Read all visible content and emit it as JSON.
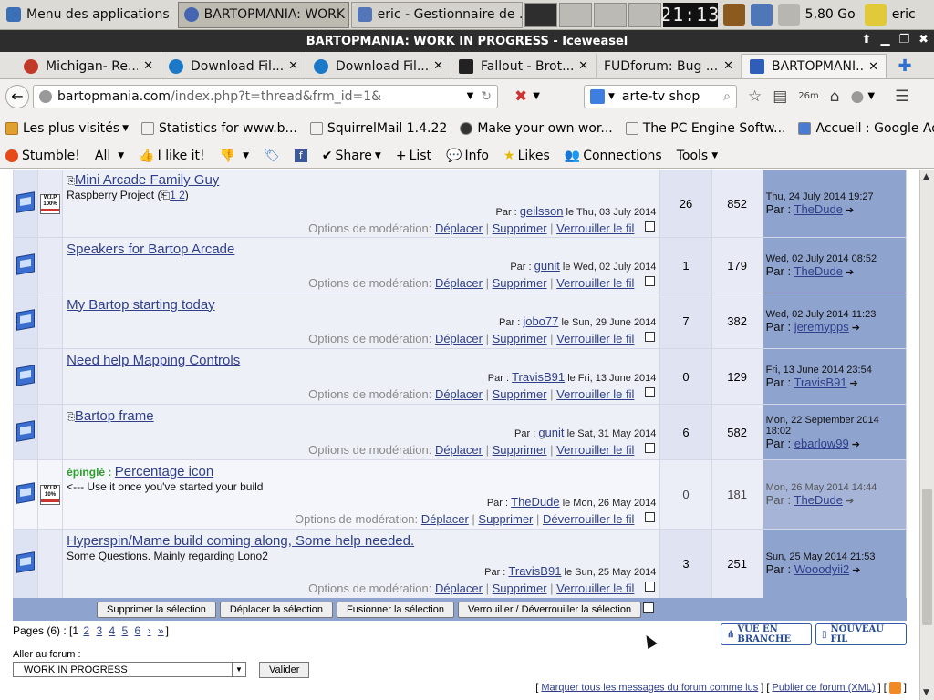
{
  "panel": {
    "apps_menu": "Menu des applications",
    "tasks": [
      {
        "label": "BARTOPMANIA: WORK ...",
        "active": true
      },
      {
        "label": "eric - Gestionnaire de ...",
        "active": false
      }
    ],
    "clock": "21:13",
    "disk": "5,80 Go",
    "user": "eric"
  },
  "window": {
    "title": "BARTOPMANIA: WORK IN PROGRESS - Iceweasel"
  },
  "tabs": [
    {
      "label": "Michigan- Re...",
      "color": "#c0392b"
    },
    {
      "label": "Download Fil...",
      "color": "#1e78c8"
    },
    {
      "label": "Download Fil...",
      "color": "#1e78c8"
    },
    {
      "label": "Fallout - Brot...",
      "color": "#222222"
    },
    {
      "label": "FUDforum: Bug ...",
      "color": "#ffffff"
    },
    {
      "label": "BARTOPMANI...",
      "color": "#2f5db8"
    }
  ],
  "nav": {
    "url_host": "bartopmania.com",
    "url_path": "/index.php?t=thread&frm_id=1&",
    "search_value": "arte-tv shop",
    "time_badge": "26m"
  },
  "bookmarks": [
    "Les plus visités",
    "Statistics for www.b...",
    "SquirrelMail 1.4.22",
    "Make your own wor...",
    "The PC Engine Softw...",
    "Accueil : Google AdS..."
  ],
  "stumble": {
    "stumble": "Stumble!",
    "all": "All",
    "like": "I like it!",
    "share": "Share",
    "list": "List",
    "info": "Info",
    "likes": "Likes",
    "connections": "Connections",
    "tools": "Tools"
  },
  "labels": {
    "by": "Par :",
    "mod_options": "Options de modération:",
    "move": "Déplacer",
    "delete": "Supprimer",
    "lock": "Verrouiller le fil",
    "unlock": "Déverrouiller le fil",
    "pinned": "épinglé :",
    "last_by": "Par :"
  },
  "threads": [
    {
      "title": "Mini Arcade Family Guy",
      "sub": "Raspberry Project (",
      "pages": "1 2",
      "author": "geilsson",
      "date": "le Thu, 03 July 2014",
      "replies": "26",
      "views": "852",
      "last_date": "Thu, 24 July 2014 19:27",
      "last_user": "TheDude",
      "wip": "W.I.P 100%"
    },
    {
      "title": "Speakers for Bartop Arcade",
      "author": "gunit",
      "date": "le Wed, 02 July 2014",
      "replies": "1",
      "views": "179",
      "last_date": "Wed, 02 July 2014 08:52",
      "last_user": "TheDude"
    },
    {
      "title": "My Bartop starting today",
      "author": "jobo77",
      "date": "le Sun, 29 June 2014",
      "replies": "7",
      "views": "382",
      "last_date": "Wed, 02 July 2014 11:23",
      "last_user": "jeremypps"
    },
    {
      "title": "Need help Mapping Controls",
      "author": "TravisB91",
      "date": "le Fri, 13 June 2014",
      "replies": "0",
      "views": "129",
      "last_date": "Fri, 13 June 2014 23:54",
      "last_user": "TravisB91"
    },
    {
      "title": "Bartop frame",
      "author": "gunit",
      "date": "le Sat, 31 May 2014",
      "replies": "6",
      "views": "582",
      "last_date": "Mon, 22 September 2014 18:02",
      "last_user": "ebarlow99"
    },
    {
      "title": "Percentage icon",
      "sub": "<--- Use it once you've started your build",
      "author": "TheDude",
      "date": "le Mon, 26 May 2014",
      "replies": "0",
      "views": "181",
      "last_date": "Mon, 26 May 2014 14:44",
      "last_user": "TheDude",
      "wip": "W.I.P 10%"
    },
    {
      "title": "Hyperspin/Mame build coming along, Some help needed.",
      "sub": "Some Questions. Mainly regarding Lono2",
      "author": "TravisB91",
      "date": "le Sun, 25 May 2014",
      "replies": "3",
      "views": "251",
      "last_date": "Sun, 25 May 2014 21:53",
      "last_user": "Wooodyii2"
    }
  ],
  "actions": {
    "delete_sel": "Supprimer la sélection",
    "move_sel": "Déplacer la sélection",
    "merge_sel": "Fusionner la sélection",
    "lock_sel": "Verrouiller / Déverrouiller la sélection"
  },
  "pager": {
    "prefix": "Pages (6) : [",
    "current": "1",
    "links": [
      "2",
      "3",
      "4",
      "5",
      "6",
      "›",
      "»"
    ],
    "suffix": "]"
  },
  "buttons": {
    "tree_view": "VUE EN BRANCHE",
    "new_thread": "NOUVEAU FIL"
  },
  "goto": {
    "label": "Aller au forum :",
    "selected": "WORK IN PROGRESS",
    "submit": "Valider"
  },
  "footer": {
    "mark_read": "Marquer tous les messages du forum comme lus",
    "syndicate": "Publier ce forum (XML)"
  }
}
